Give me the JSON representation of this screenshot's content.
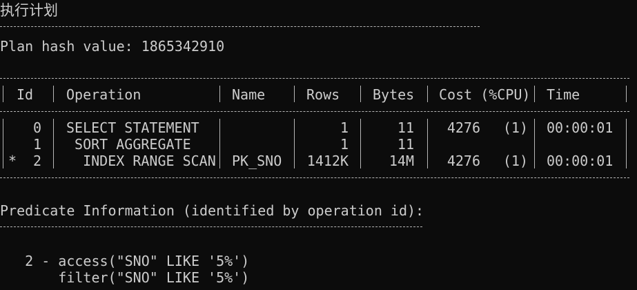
{
  "title": "执行计划",
  "plan_hash_line": "Plan hash value: 1865342910",
  "table": {
    "headers": {
      "id": "Id",
      "operation": "Operation",
      "name": "Name",
      "rows": "Rows",
      "bytes": "Bytes",
      "cost": "Cost (%CPU)",
      "time": "Time"
    },
    "rows": [
      {
        "marker": "",
        "id": "0",
        "operation": "SELECT STATEMENT",
        "name": "",
        "rows": "1",
        "bytes": "11",
        "cost": "4276",
        "cpu": "(1)",
        "time": "00:00:01"
      },
      {
        "marker": "",
        "id": "1",
        "operation": " SORT AGGREGATE",
        "name": "",
        "rows": "1",
        "bytes": "11",
        "cost": "",
        "cpu": "",
        "time": ""
      },
      {
        "marker": "*",
        "id": "2",
        "operation": "  INDEX RANGE SCAN",
        "name": "PK_SNO",
        "rows": "1412K",
        "bytes": "14M",
        "cost": "4276",
        "cpu": "(1)",
        "time": "00:00:01"
      }
    ]
  },
  "predicate_title": "Predicate Information (identified by operation id):",
  "predicates": [
    "   2 - access(\"SNO\" LIKE '5%')",
    "       filter(\"SNO\" LIKE '5%')"
  ]
}
